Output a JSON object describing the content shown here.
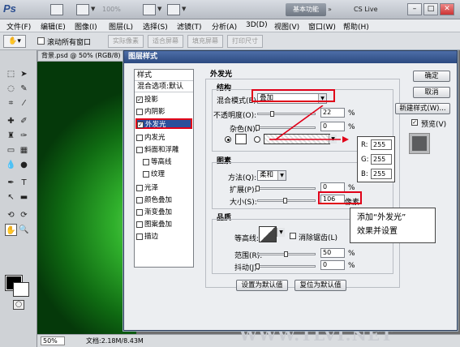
{
  "app": {
    "logo": "Ps",
    "zoom": "100%",
    "workspace": "基本功能",
    "cslive": "CS Live",
    "win_min": "–",
    "win_max": "□",
    "win_close": "✕"
  },
  "menu": [
    "文件(F)",
    "编辑(E)",
    "图像(I)",
    "图层(L)",
    "选择(S)",
    "滤镜(T)",
    "分析(A)",
    "3D(D)",
    "视图(V)",
    "窗口(W)",
    "帮助(H)"
  ],
  "options": {
    "scroll_all": "滚动所有窗口",
    "buttons": [
      "实际像素",
      "适合屏幕",
      "填充屏幕",
      "打印尺寸"
    ]
  },
  "document": {
    "tab": "背景.psd @ 50% (RGB/8)",
    "zoom": "50%",
    "info": "文档:2.18M/8.43M"
  },
  "dialog": {
    "title": "图层样式",
    "styles_header": "样式",
    "blend_options": "混合选项:默认",
    "styles": [
      {
        "label": "投影",
        "checked": true
      },
      {
        "label": "内阴影",
        "checked": false
      },
      {
        "label": "外发光",
        "checked": true
      },
      {
        "label": "内发光",
        "checked": false
      },
      {
        "label": "斜面和浮雕",
        "checked": false
      },
      {
        "label": "等高线",
        "checked": false
      },
      {
        "label": "纹理",
        "checked": false
      },
      {
        "label": "光泽",
        "checked": false
      },
      {
        "label": "颜色叠加",
        "checked": false
      },
      {
        "label": "渐变叠加",
        "checked": false
      },
      {
        "label": "图案叠加",
        "checked": false
      },
      {
        "label": "描边",
        "checked": false
      }
    ],
    "section_title": "外发光",
    "structure": {
      "title": "结构",
      "blend_mode_label": "混合模式(E):",
      "blend_mode": "叠加",
      "opacity_label": "不透明度(O):",
      "opacity": "22",
      "noise_label": "杂色(N):",
      "noise": "0",
      "percent": "%"
    },
    "elements": {
      "title": "图素",
      "technique_label": "方法(Q):",
      "technique": "柔和",
      "spread_label": "扩展(P):",
      "spread": "0",
      "size_label": "大小(S):",
      "size": "106",
      "px": "像素"
    },
    "quality": {
      "title": "品质",
      "contour_label": "等高线:",
      "antialias_label": "消除锯齿(L)",
      "range_label": "范围(R):",
      "range": "50",
      "jitter_label": "抖动(J):",
      "jitter": "0"
    },
    "default_buttons": {
      "set": "设置为默认值",
      "reset": "复位为默认值"
    },
    "buttons": {
      "ok": "确定",
      "cancel": "取消",
      "new_style": "新建样式(W)...",
      "preview": "预览(V)"
    }
  },
  "rgb": {
    "r_label": "R:",
    "r": "255",
    "g_label": "G:",
    "g": "255",
    "b_label": "B:",
    "b": "255"
  },
  "callout": {
    "line1": "添加“外发光”",
    "line2": "效果并设置"
  },
  "watermark": "腾龍視覺WWW.TLVI.NET"
}
